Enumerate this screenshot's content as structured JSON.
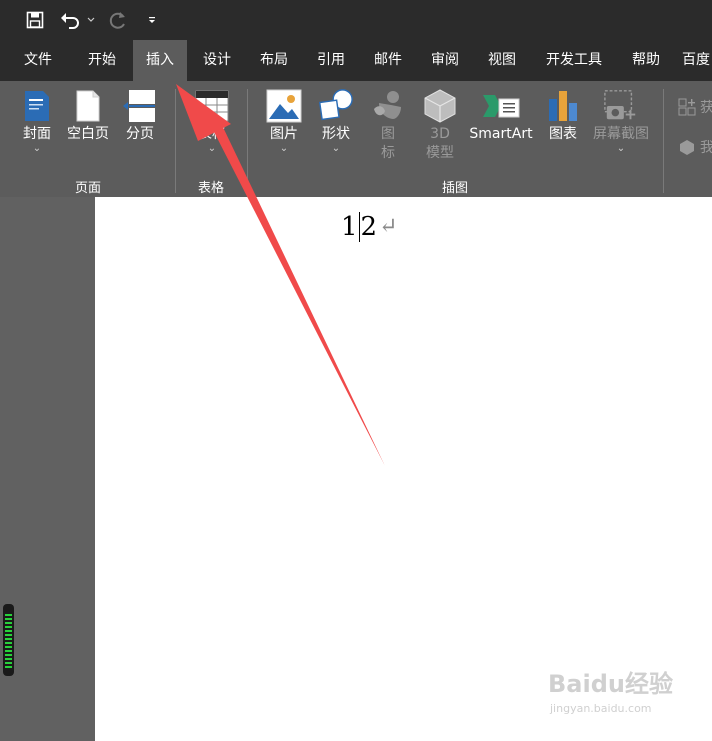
{
  "quick_access": {
    "save_icon": "save-icon",
    "undo_icon": "undo-icon",
    "redo_icon": "redo-icon",
    "more_icon": "customize-toolbar-icon"
  },
  "tabs": [
    {
      "label": "文件"
    },
    {
      "label": "开始"
    },
    {
      "label": "插入",
      "active": true
    },
    {
      "label": "设计"
    },
    {
      "label": "布局"
    },
    {
      "label": "引用"
    },
    {
      "label": "邮件"
    },
    {
      "label": "审阅"
    },
    {
      "label": "视图"
    },
    {
      "label": "开发工具"
    },
    {
      "label": "帮助"
    },
    {
      "label": "百度"
    }
  ],
  "ribbon": {
    "pages_group": {
      "label": "页面",
      "cover": "封面",
      "blank_page": "空白页",
      "page_break": "分页"
    },
    "tables_group": {
      "label": "表格",
      "table": "表格"
    },
    "illustrations_group": {
      "label": "插图",
      "picture": "图片",
      "shapes": "形状",
      "icons": "图标",
      "icons_line1": "图",
      "icons_line2": "标",
      "model3d_line1": "3D",
      "model3d_line2": "模型",
      "smartart": "SmartArt",
      "chart": "图表",
      "screenshot": "屏幕截图"
    },
    "side": {
      "get_addins_partial": "获",
      "my_addins_partial": "我"
    }
  },
  "document": {
    "text_before_caret": "1",
    "text_after_caret": "2",
    "paragraph_mark": "↵"
  },
  "colors": {
    "dark_bar": "#2b2b2b",
    "ribbon": "#5c5c5c",
    "arrow": "#f04a4a",
    "word_blue": "#2b6cb5"
  },
  "watermark": {
    "logo": "Baidu经验",
    "url": "jingyan.baidu.com"
  }
}
